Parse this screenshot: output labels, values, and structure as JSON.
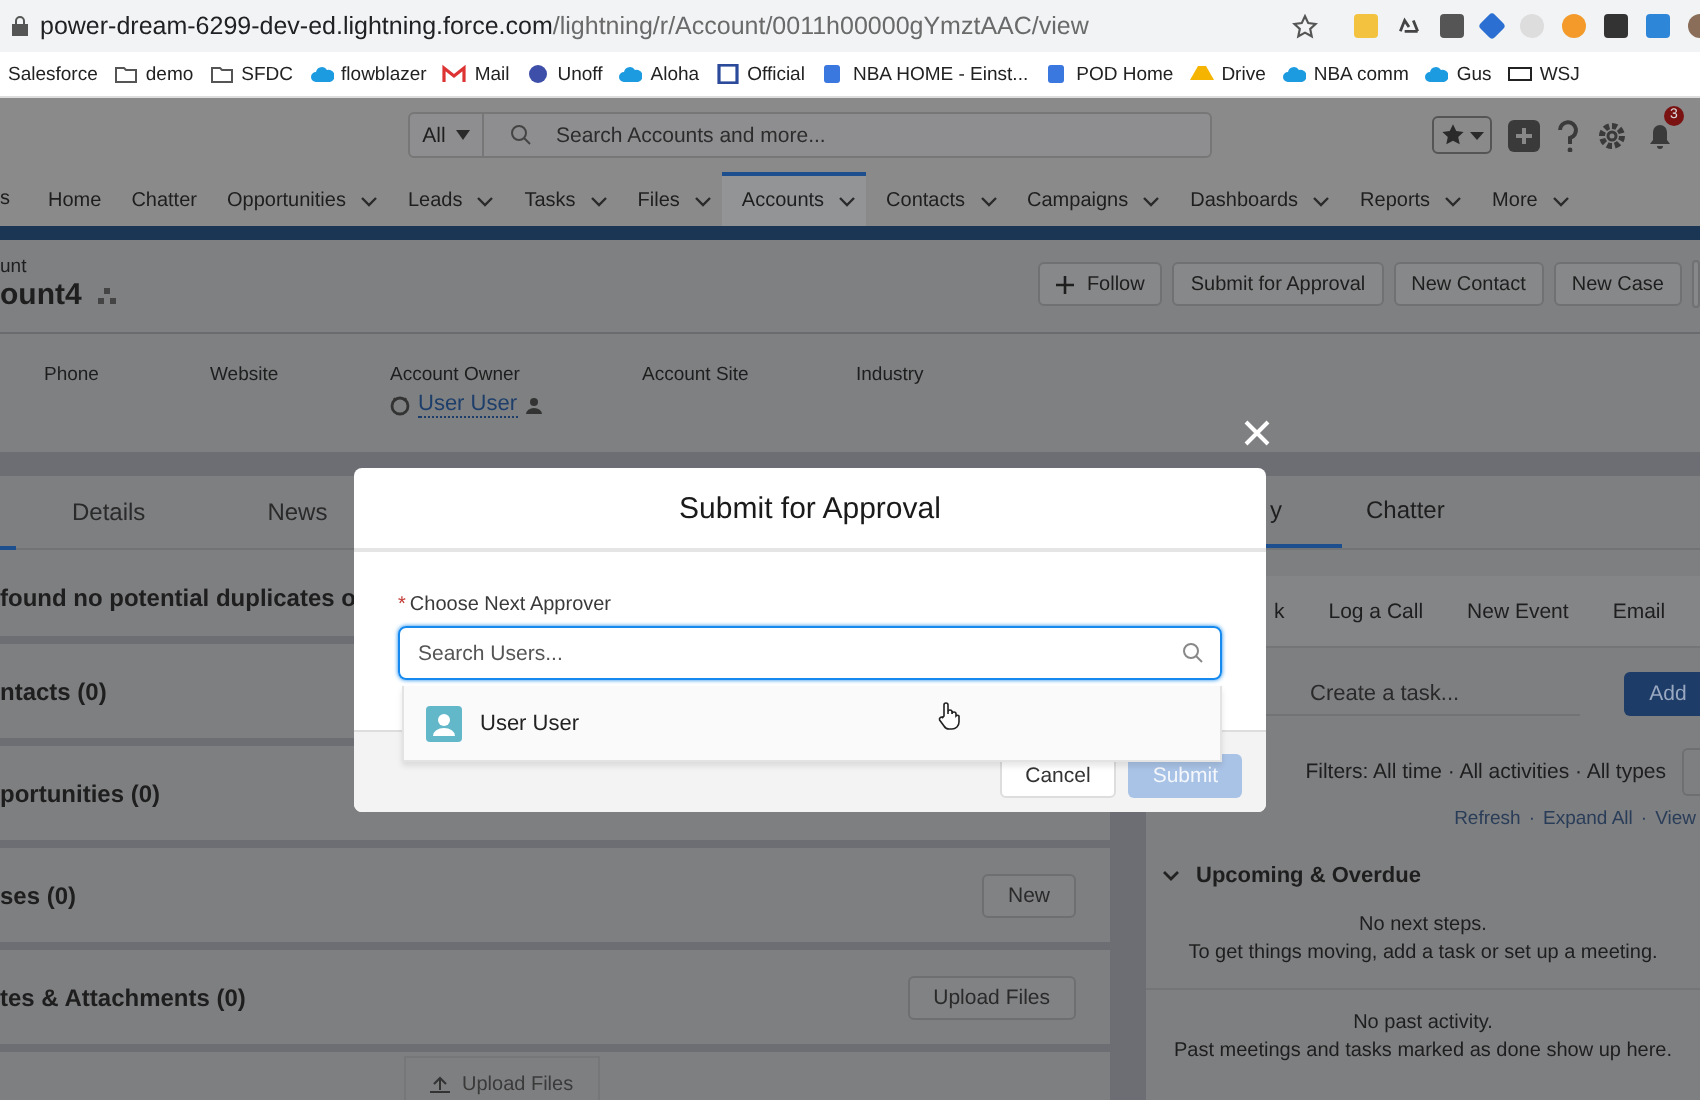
{
  "browser": {
    "url_host": "power-dream-6299-dev-ed.lightning.force.com",
    "url_path": "/lightning/r/Account/0011h00000gYmztAAC/view"
  },
  "bookmarks": [
    {
      "label": "Salesforce",
      "kind": "cloud"
    },
    {
      "label": "demo",
      "kind": "folder"
    },
    {
      "label": "SFDC",
      "kind": "folder"
    },
    {
      "label": "flowblazer",
      "kind": "cloud"
    },
    {
      "label": "Mail",
      "kind": "mail"
    },
    {
      "label": "Unoff",
      "kind": "circle"
    },
    {
      "label": "Aloha",
      "kind": "cloud"
    },
    {
      "label": "Official",
      "kind": "calendar"
    },
    {
      "label": "NBA HOME - Einst...",
      "kind": "page"
    },
    {
      "label": "POD Home",
      "kind": "page"
    },
    {
      "label": "Drive",
      "kind": "drive"
    },
    {
      "label": "NBA comm",
      "kind": "cloud"
    },
    {
      "label": "Gus",
      "kind": "cloud"
    },
    {
      "label": "WSJ",
      "kind": "news"
    }
  ],
  "header": {
    "scope": "All",
    "search_placeholder": "Search Accounts and more...",
    "notifications": "3"
  },
  "nav": {
    "app": "s",
    "items": [
      {
        "label": "Home",
        "menu": false,
        "selected": false
      },
      {
        "label": "Chatter",
        "menu": false,
        "selected": false
      },
      {
        "label": "Opportunities",
        "menu": true,
        "selected": false
      },
      {
        "label": "Leads",
        "menu": true,
        "selected": false
      },
      {
        "label": "Tasks",
        "menu": true,
        "selected": false
      },
      {
        "label": "Files",
        "menu": true,
        "selected": false
      },
      {
        "label": "Accounts",
        "menu": true,
        "selected": true
      },
      {
        "label": "Contacts",
        "menu": true,
        "selected": false
      },
      {
        "label": "Campaigns",
        "menu": true,
        "selected": false
      },
      {
        "label": "Dashboards",
        "menu": true,
        "selected": false
      },
      {
        "label": "Reports",
        "menu": true,
        "selected": false
      },
      {
        "label": "More",
        "menu": true,
        "selected": false
      }
    ]
  },
  "record": {
    "type": "unt",
    "name": "ount4",
    "actions": [
      "Follow",
      "Submit for Approval",
      "New Contact",
      "New Case"
    ],
    "fields": [
      {
        "label": "Phone"
      },
      {
        "label": "Website"
      },
      {
        "label": "Account Owner",
        "value": "User User"
      },
      {
        "label": "Account Site"
      },
      {
        "label": "Industry"
      }
    ]
  },
  "left": {
    "tabs": [
      {
        "label": "Details",
        "selected": false
      },
      {
        "label": "News",
        "selected": false
      }
    ],
    "duplicates": "found no potential duplicates o",
    "related": [
      {
        "title": "ntacts (0)"
      },
      {
        "title": "portunities (0)"
      },
      {
        "title": "ses (0)",
        "action": "New"
      },
      {
        "title": "tes & Attachments (0)",
        "action": "Upload Files"
      }
    ],
    "upload": "Upload Files"
  },
  "right": {
    "tabs": [
      {
        "label": "y",
        "selected": true
      },
      {
        "label": "Chatter",
        "selected": false
      }
    ],
    "composer_tabs": [
      "k",
      "Log a Call",
      "New Event",
      "Email"
    ],
    "task_placeholder": "Create a task...",
    "add": "Add",
    "filters": "Filters: All time · All activities · All types",
    "links": [
      "Refresh",
      "Expand All",
      "View"
    ],
    "link_separator": "·",
    "upcoming": "Upcoming & Overdue",
    "no_next": "No next steps.",
    "no_next_hint": "To get things moving, add a task or set up a meeting.",
    "no_past": "No past activity.",
    "no_past_hint": "Past meetings and tasks marked as done show up here."
  },
  "modal": {
    "title": "Submit for Approval",
    "field_label": "Choose Next Approver",
    "required_mark": "*",
    "placeholder": "Search Users...",
    "options": [
      {
        "label": "User User"
      }
    ],
    "cancel": "Cancel",
    "submit": "Submit",
    "submit_disabled": true
  }
}
